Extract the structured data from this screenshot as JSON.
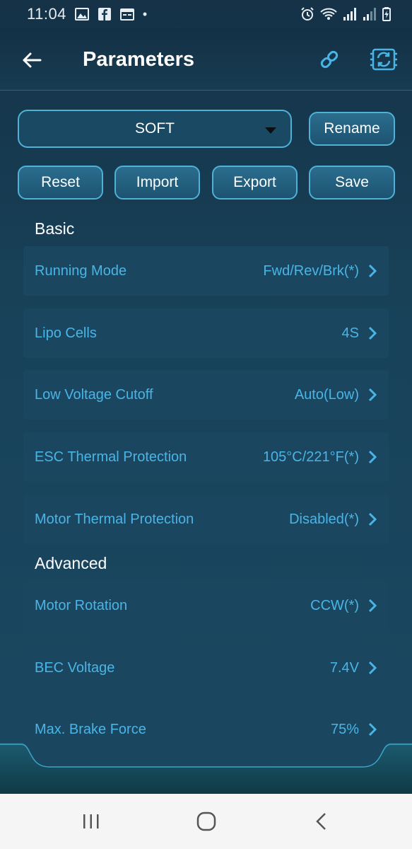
{
  "status_bar": {
    "time": "11:04",
    "dot": "•"
  },
  "app_bar": {
    "title": "Parameters"
  },
  "profile": {
    "selected": "SOFT",
    "rename_label": "Rename"
  },
  "actions": {
    "reset": "Reset",
    "import": "Import",
    "export": "Export",
    "save": "Save"
  },
  "sections": {
    "basic": {
      "title": "Basic",
      "items": [
        {
          "label": "Running Mode",
          "value": "Fwd/Rev/Brk(*)"
        },
        {
          "label": "Lipo Cells",
          "value": "4S"
        },
        {
          "label": "Low Voltage Cutoff",
          "value": "Auto(Low)"
        },
        {
          "label": "ESC Thermal Protection",
          "value": "105°C/221°F(*)"
        },
        {
          "label": "Motor Thermal Protection",
          "value": "Disabled(*)"
        }
      ]
    },
    "advanced": {
      "title": "Advanced",
      "items": [
        {
          "label": "Motor Rotation",
          "value": "CCW(*)"
        },
        {
          "label": "BEC Voltage",
          "value": "7.4V"
        },
        {
          "label": "Max. Brake Force",
          "value": "75%"
        }
      ]
    }
  },
  "colors": {
    "accent": "#49b5e6",
    "border": "#4fb0d8",
    "background": "#184259"
  }
}
